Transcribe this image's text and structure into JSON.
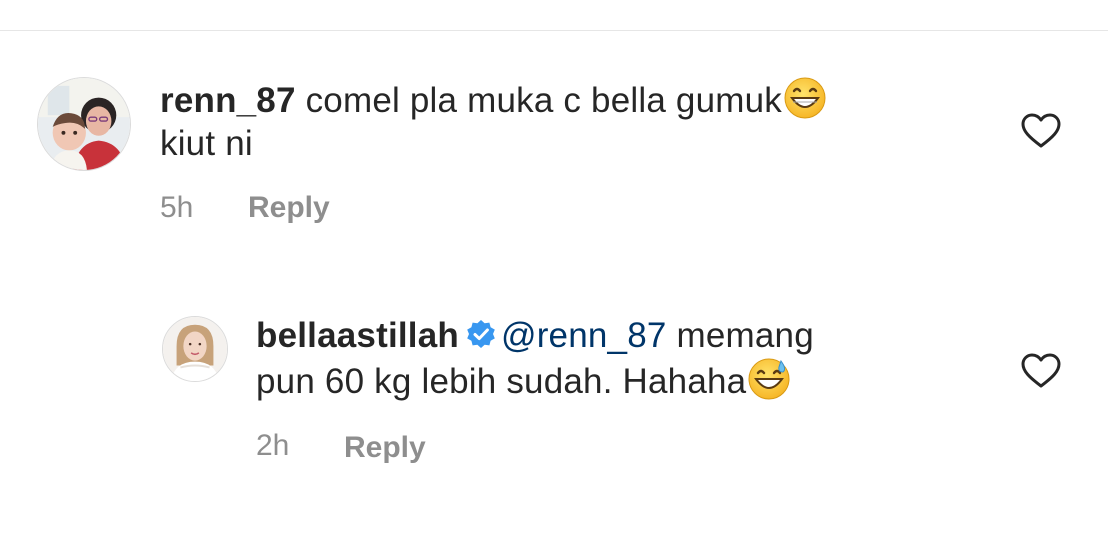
{
  "comments": [
    {
      "username": "renn_87",
      "text": "comel pla muka c bella gumuk",
      "text_line2": "kiut ni",
      "emoji": "grinning-face-emoji",
      "time": "5h",
      "reply_label": "Reply",
      "verified": false
    },
    {
      "username": "bellaastillah",
      "mention": "@renn_87",
      "text": "memang",
      "text_line2": "pun 60 kg lebih sudah. Hahaha",
      "emoji": "grinning-sweat-emoji",
      "time": "2h",
      "reply_label": "Reply",
      "verified": true,
      "is_reply": true
    }
  ],
  "colors": {
    "text": "#262626",
    "secondary": "#8e8e8e",
    "mention": "#003569",
    "verified": "#3897f0",
    "divider": "#e6e6e6"
  },
  "icons": {
    "like": "heart-outline-icon",
    "verified": "verified-badge-icon"
  }
}
